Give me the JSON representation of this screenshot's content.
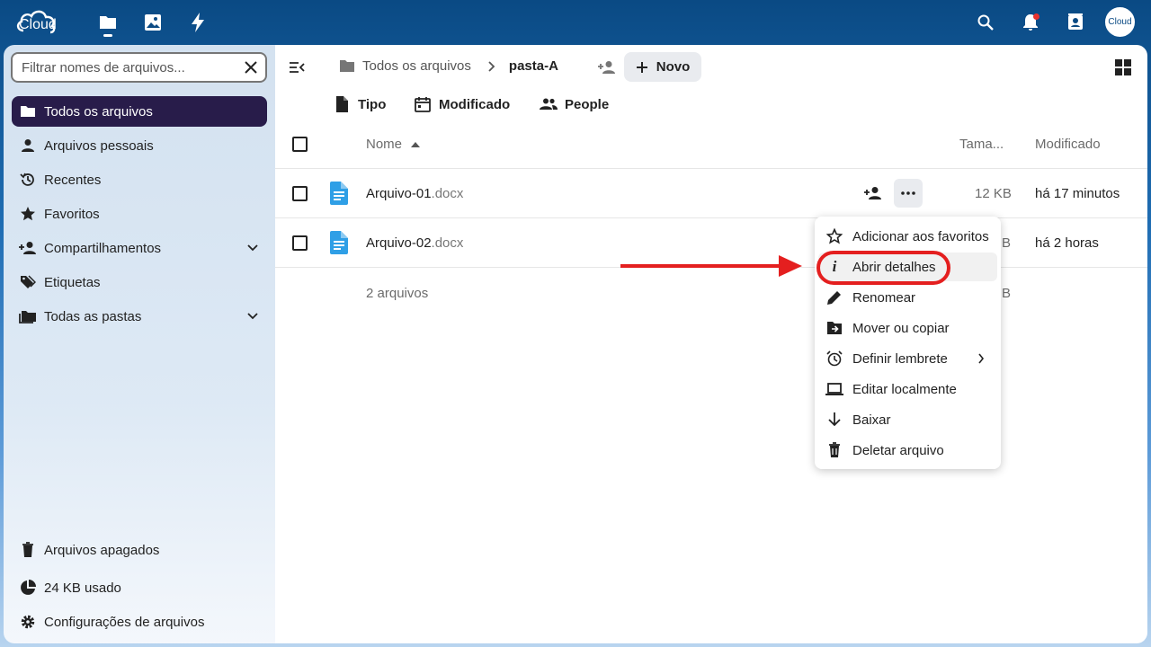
{
  "header": {
    "logo_text": "Cloud",
    "apps": [
      "files-icon",
      "photos-icon",
      "activity-icon"
    ],
    "right_icons": [
      "search-icon",
      "bell-icon",
      "contacts-icon"
    ],
    "avatar_text": "Cloud"
  },
  "sidebar": {
    "filter_placeholder": "Filtrar nomes de arquivos...",
    "items": [
      {
        "label": "Todos os arquivos",
        "icon": "folder-icon",
        "active": true
      },
      {
        "label": "Arquivos pessoais",
        "icon": "user-icon"
      },
      {
        "label": "Recentes",
        "icon": "history-icon"
      },
      {
        "label": "Favoritos",
        "icon": "star-icon"
      },
      {
        "label": "Compartilhamentos",
        "icon": "share-icon",
        "expandable": true
      },
      {
        "label": "Etiquetas",
        "icon": "tag-icon"
      },
      {
        "label": "Todas as pastas",
        "icon": "folders-icon",
        "expandable": true
      }
    ],
    "footer": [
      {
        "label": "Arquivos apagados",
        "icon": "trash-icon"
      },
      {
        "label": "24 KB usado",
        "icon": "pie-chart-icon"
      },
      {
        "label": "Configurações de arquivos",
        "icon": "gear-icon"
      }
    ]
  },
  "breadcrumb": {
    "root": "Todos os arquivos",
    "current": "pasta-A"
  },
  "new_button": "Novo",
  "filters": [
    "Tipo",
    "Modificado",
    "People"
  ],
  "table": {
    "columns": {
      "name": "Nome",
      "size": "Tama...",
      "modified": "Modificado"
    },
    "rows": [
      {
        "base": "Arquivo-01",
        "ext": ".docx",
        "size": "12 KB",
        "modified": "há 17 minutos"
      },
      {
        "base": "Arquivo-02",
        "ext": ".docx",
        "size": "B",
        "modified": "há 2 horas"
      }
    ],
    "summary": "2 arquivos",
    "summary_size": "B"
  },
  "context_menu": {
    "items": [
      {
        "label": "Adicionar aos favoritos",
        "icon": "star-outline-icon"
      },
      {
        "label": "Abrir detalhes",
        "icon": "info-icon"
      },
      {
        "label": "Renomear",
        "icon": "pencil-icon"
      },
      {
        "label": "Mover ou copiar",
        "icon": "folder-move-icon"
      },
      {
        "label": "Definir lembrete",
        "icon": "alarm-icon"
      },
      {
        "label": "Editar localmente",
        "icon": "laptop-icon"
      },
      {
        "label": "Baixar",
        "icon": "download-icon"
      },
      {
        "label": "Deletar arquivo",
        "icon": "trash-icon"
      }
    ]
  },
  "colors": {
    "header_bg": "#0a4a84",
    "active_nav": "#281c4a",
    "file_icon": "#2f9fe6",
    "annotation_red": "#e41f1f"
  }
}
